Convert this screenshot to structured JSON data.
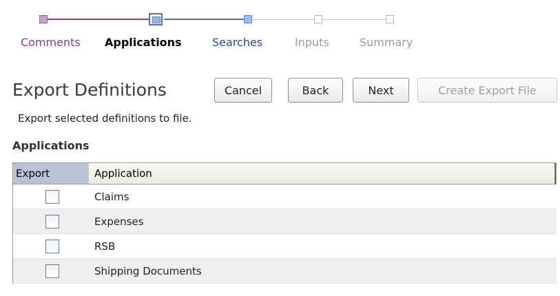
{
  "train": {
    "steps": [
      {
        "label": "Comments",
        "state": "visited"
      },
      {
        "label": "Applications",
        "state": "current"
      },
      {
        "label": "Searches",
        "state": "next"
      },
      {
        "label": "Inputs",
        "state": "future"
      },
      {
        "label": "Summary",
        "state": "future"
      }
    ]
  },
  "header": {
    "title": "Export Definitions",
    "cancel_label": "Cancel",
    "back_label": "Back",
    "next_label": "Next",
    "create_label": "Create Export File"
  },
  "instructions": "Export selected definitions to file.",
  "section": {
    "title": "Applications"
  },
  "table": {
    "columns": [
      "Export",
      "Application"
    ],
    "rows": [
      {
        "application": "Claims",
        "export": false
      },
      {
        "application": "Expenses",
        "export": false
      },
      {
        "application": "RSB",
        "export": false
      },
      {
        "application": "Shipping Documents",
        "export": false
      }
    ]
  },
  "colors": {
    "visited": "#8e3a8e",
    "current": "#4a6fcf",
    "next": "#1d4aa6",
    "future": "#9a9a9a",
    "header_export_bg": "#b8c3d6"
  }
}
